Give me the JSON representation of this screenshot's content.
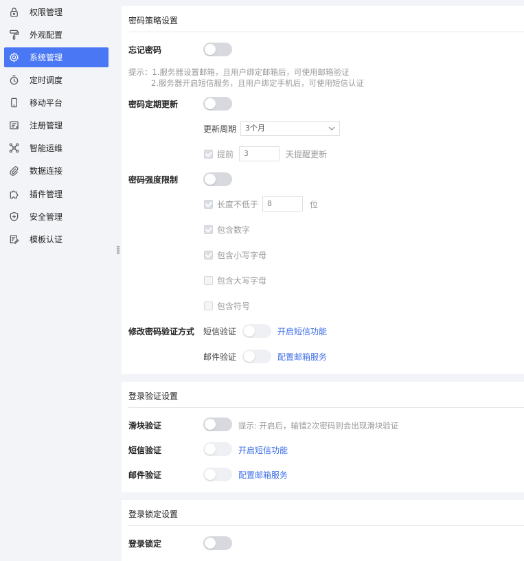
{
  "sidebar": {
    "items": [
      {
        "label": "权限管理",
        "icon": "lock-icon"
      },
      {
        "label": "外观配置",
        "icon": "paint-roller-icon"
      },
      {
        "label": "系统管理",
        "icon": "gear-icon",
        "active": true
      },
      {
        "label": "定时调度",
        "icon": "timer-icon"
      },
      {
        "label": "移动平台",
        "icon": "mobile-icon"
      },
      {
        "label": "注册管理",
        "icon": "register-icon"
      },
      {
        "label": "智能运维",
        "icon": "network-icon"
      },
      {
        "label": "数据连接",
        "icon": "paperclip-icon"
      },
      {
        "label": "插件管理",
        "icon": "puzzle-icon"
      },
      {
        "label": "安全管理",
        "icon": "shield-icon"
      },
      {
        "label": "模板认证",
        "icon": "template-cert-icon"
      }
    ]
  },
  "password_policy": {
    "title": "密码策略设置",
    "forgot_password": {
      "label": "忘记密码",
      "enabled": false
    },
    "hint_line1": "提示：1.服务器设置邮箱，且用户绑定邮箱后，可使用邮箱验证",
    "hint_line2": "2.服务器开启短信服务，且用户绑定手机后，可使用短信认证",
    "periodic_update": {
      "label": "密码定期更新",
      "enabled": false,
      "period_label": "更新周期",
      "period_value": "3个月",
      "remind_checked": true,
      "remind_prefix": "提前",
      "remind_days": "3",
      "remind_suffix": "天提醒更新"
    },
    "strength": {
      "label": "密码强度限制",
      "enabled": false,
      "min_length_label": "长度不低于",
      "min_length_value": "8",
      "min_length_unit": "位",
      "min_length_checked": true,
      "digits_label": "包含数字",
      "digits_checked": true,
      "lowercase_label": "包含小写字母",
      "lowercase_checked": true,
      "uppercase_label": "包含大写字母",
      "uppercase_checked": false,
      "symbols_label": "包含符号",
      "symbols_checked": false
    },
    "modify_verify": {
      "label": "修改密码验证方式",
      "sms_label": "短信验证",
      "sms_link": "开启短信功能",
      "email_label": "邮件验证",
      "email_link": "配置邮箱服务"
    }
  },
  "login_verify": {
    "title": "登录验证设置",
    "slider_label": "滑块验证",
    "slider_hint": "提示: 开启后，输错2次密码则会出现滑块验证",
    "sms_label": "短信验证",
    "sms_link": "开启短信功能",
    "email_label": "邮件验证",
    "email_link": "配置邮箱服务"
  },
  "login_lock": {
    "title": "登录锁定设置",
    "lock_label": "登录锁定",
    "enabled": false
  },
  "colors": {
    "accent": "#4a78f4",
    "link": "#3f6fe8"
  }
}
